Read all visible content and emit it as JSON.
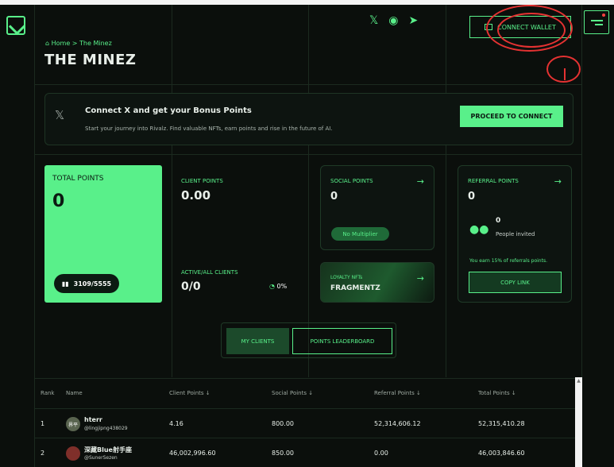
{
  "breadcrumb": {
    "home": "Home",
    "separator": ">",
    "current": "The Minez"
  },
  "page": {
    "title": "THE MINEZ"
  },
  "header": {
    "connect_wallet": "CONNECT WALLET"
  },
  "banner": {
    "title": "Connect X and get your Bonus Points",
    "subtitle": "Start your journey into Rivalz. Find valuable NFTs, earn points and rise in the future of AI.",
    "button": "PROCEED TO CONNECT"
  },
  "total_points": {
    "label": "TOTAL POINTS",
    "value": "0",
    "rank": "3109/5555"
  },
  "client_points": {
    "label": "CLIENT POINTS",
    "value": "0.00",
    "active_label": "ACTIVE/ALL CLIENTS",
    "active_value": "0/0",
    "percent": "0%"
  },
  "social_points": {
    "label": "SOCIAL POINTS",
    "value": "0",
    "multiplier": "No Multiplier"
  },
  "loyalty": {
    "label": "LOYALTY NFTs",
    "value": "FRAGMENTZ"
  },
  "referral": {
    "label": "REFERRAL POINTS",
    "value": "0",
    "invited_count": "0",
    "invited_label": "People invited",
    "note": "You earn 15% of referrals points.",
    "copy_link": "COPY LINK"
  },
  "tabs": [
    {
      "label": "MY CLIENTS"
    },
    {
      "label": "POINTS LEADERBOARD"
    }
  ],
  "table": {
    "columns": [
      "Rank",
      "Name",
      "Client Points ↓",
      "Social Points ↓",
      "Referral Points ↓",
      "Total Points ↓"
    ],
    "rows": [
      {
        "rank": "1",
        "avatar_text": "界平",
        "name": "hterr",
        "handle": "@lingjipng438029",
        "client": "4.16",
        "social": "800.00",
        "referral": "52,314,606.12",
        "total": "52,315,410.28"
      },
      {
        "rank": "2",
        "avatar_text": "",
        "name": "深藏Blue射手座",
        "handle": "@SunerSezen",
        "client": "46,002,996.60",
        "social": "850.00",
        "referral": "0.00",
        "total": "46,003,846.60"
      }
    ]
  },
  "colors": {
    "accent": "#59f08a",
    "background": "#0b0f0c",
    "annotation": "#e53232"
  },
  "icons": [
    "logo",
    "home-icon",
    "x-icon",
    "discord-icon",
    "telegram-icon",
    "wallet-icon",
    "menu-icon",
    "arrow-right-icon",
    "people-icon",
    "bar-chart-icon",
    "clock-icon"
  ]
}
